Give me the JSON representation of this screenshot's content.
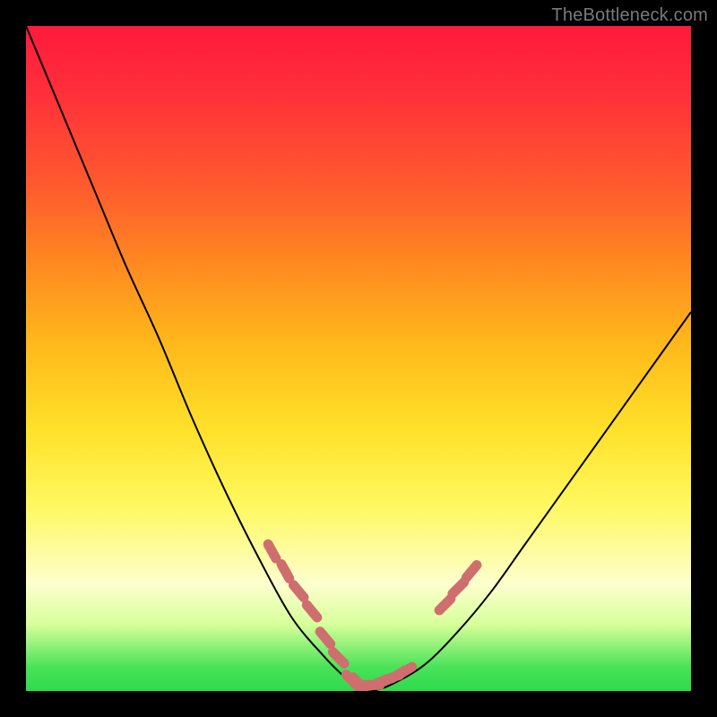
{
  "watermark": {
    "text": "TheBottleneck.com"
  },
  "colors": {
    "curve": "#000000",
    "markers": "#cf6e6e",
    "frame_bg": "#000000"
  },
  "chart_data": {
    "type": "line",
    "title": "",
    "xlabel": "",
    "ylabel": "",
    "xlim": [
      0,
      100
    ],
    "ylim": [
      0,
      100
    ],
    "grid": false,
    "legend": false,
    "series": [
      {
        "name": "bottleneck-curve",
        "x": [
          0,
          5,
          10,
          15,
          20,
          25,
          30,
          35,
          40,
          45,
          48,
          50,
          52,
          55,
          60,
          65,
          70,
          75,
          80,
          85,
          90,
          95,
          100
        ],
        "y": [
          100,
          88,
          76,
          64,
          53,
          41,
          30,
          20,
          11,
          5,
          2,
          0,
          0,
          1,
          4,
          9,
          15,
          22,
          29,
          36,
          43,
          50,
          57
        ]
      }
    ],
    "markers": [
      {
        "name": "left-cluster",
        "x": [
          37,
          39,
          41,
          43,
          45,
          47
        ],
        "y": [
          21,
          18,
          15,
          12,
          8,
          5
        ]
      },
      {
        "name": "valley-floor",
        "x": [
          49,
          50,
          51,
          52,
          53,
          54,
          55,
          56,
          57
        ],
        "y": [
          1.6,
          1.2,
          0.9,
          0.9,
          1.2,
          1.6,
          2.0,
          2.5,
          3.0
        ]
      },
      {
        "name": "right-cluster",
        "x": [
          63,
          65,
          67
        ],
        "y": [
          13,
          15.5,
          18
        ]
      }
    ]
  }
}
